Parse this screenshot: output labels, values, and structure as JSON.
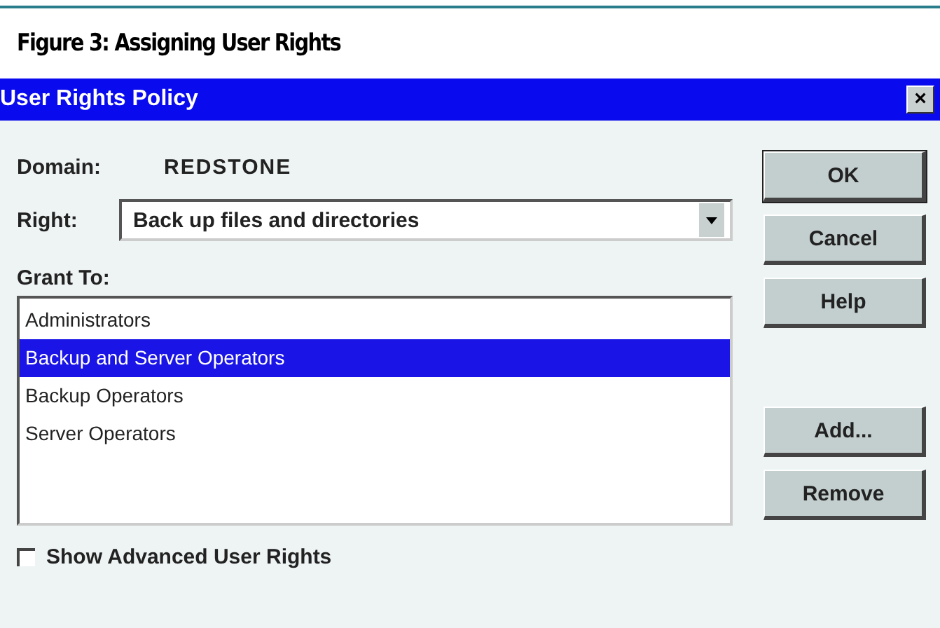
{
  "caption": "Figure 3: Assigning User Rights",
  "window": {
    "title": "User Rights Policy",
    "close": "×"
  },
  "domain": {
    "label": "Domain:",
    "value": "REDSTONE"
  },
  "right": {
    "label": "Right:",
    "value": "Back up files and directories"
  },
  "grant_to": {
    "label": "Grant To:",
    "items": [
      {
        "label": "Administrators",
        "selected": false
      },
      {
        "label": "Backup and Server Operators",
        "selected": true
      },
      {
        "label": "Backup Operators",
        "selected": false
      },
      {
        "label": "Server Operators",
        "selected": false
      }
    ]
  },
  "show_advanced": {
    "label": "Show Advanced User Rights",
    "checked": false
  },
  "buttons_top": [
    {
      "label": "OK",
      "default": true
    },
    {
      "label": "Cancel",
      "default": false
    },
    {
      "label": "Help",
      "default": false
    }
  ],
  "buttons_bottom": [
    {
      "label": "Add...",
      "default": false
    },
    {
      "label": "Remove",
      "default": false
    }
  ]
}
